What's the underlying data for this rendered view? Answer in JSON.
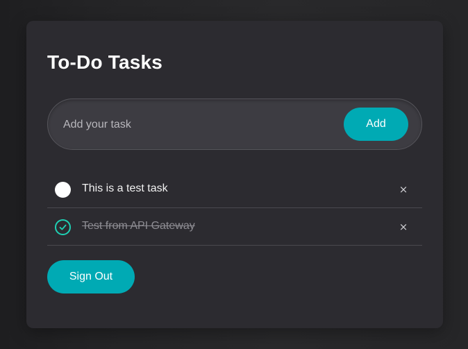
{
  "page": {
    "title": "To-Do Tasks"
  },
  "new_task": {
    "placeholder": "Add your task",
    "value": "",
    "add_label": "Add"
  },
  "tasks": [
    {
      "text": "This is a test task",
      "completed": false,
      "delete_label": "×",
      "status_icon": "empty-circle-icon"
    },
    {
      "text": "Test from API Gateway",
      "completed": true,
      "delete_label": "×",
      "status_icon": "check-circle-icon"
    }
  ],
  "sign_out_label": "Sign Out",
  "colors": {
    "accent": "#00aab4",
    "check": "#1fd1b4",
    "card": "#2c2b30",
    "input": "#3d3c42"
  }
}
